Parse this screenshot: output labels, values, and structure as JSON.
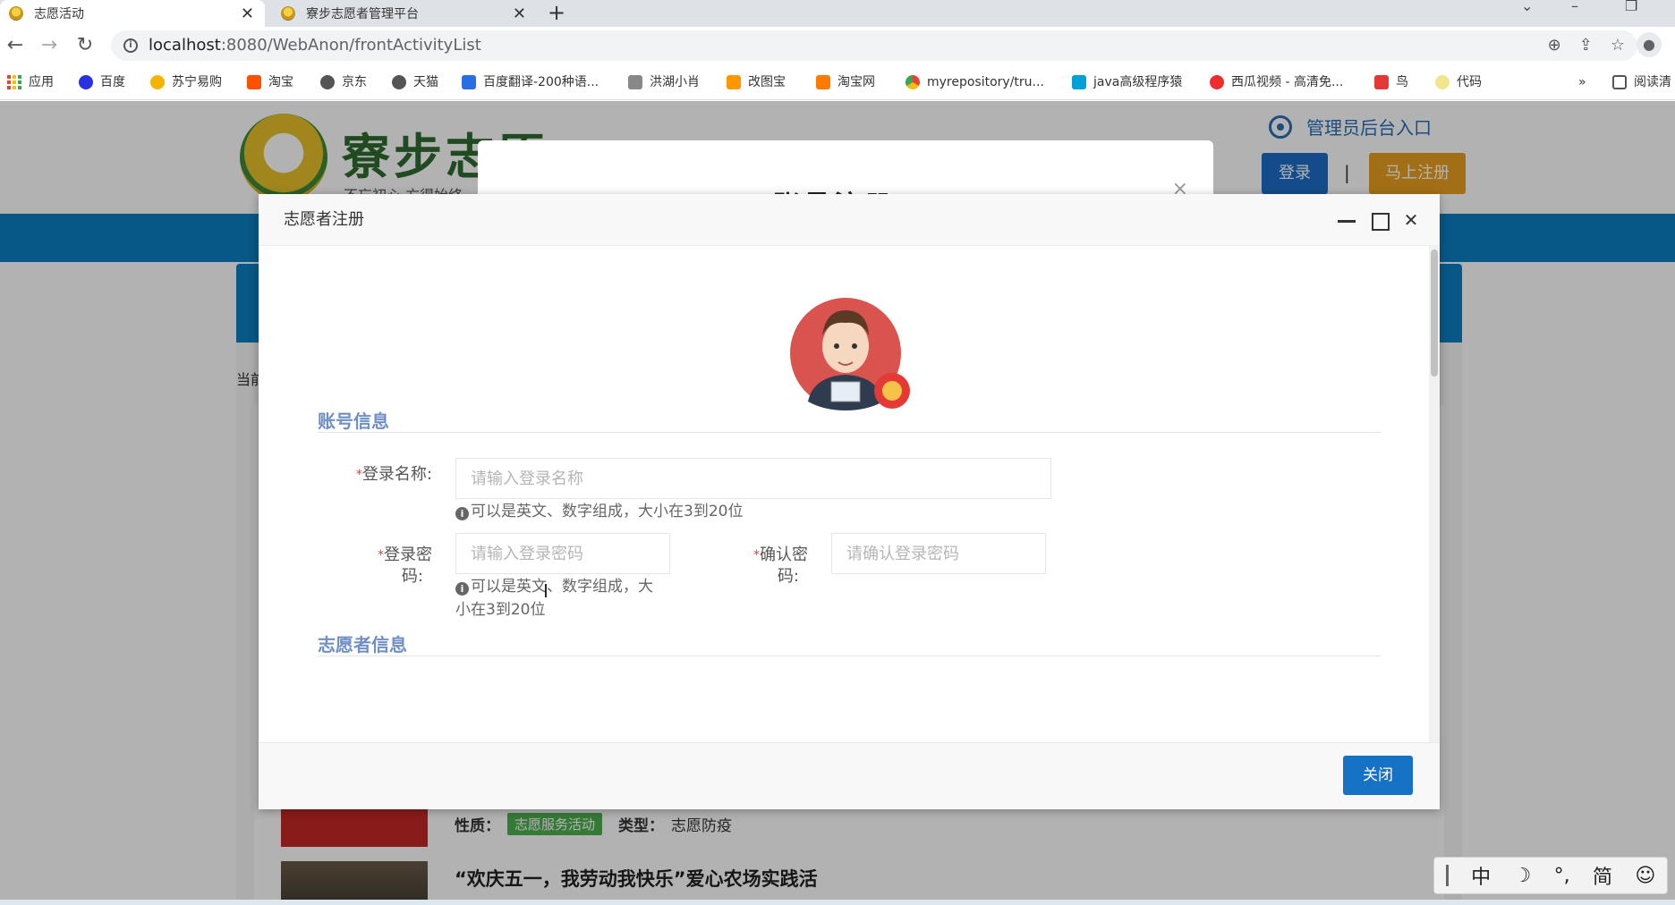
{
  "browser": {
    "tabs": [
      {
        "title": "志愿活动",
        "active": true
      },
      {
        "title": "寮步志愿者管理平台",
        "active": false
      }
    ],
    "new_tab": "+",
    "url_host": "localhost",
    "url_rest": ":8080/WebAnon/frontActivityList",
    "bookmarks": [
      "应用",
      "百度",
      "苏宁易购",
      "淘宝",
      "京东",
      "天猫",
      "百度翻译-200种语...",
      "洪湖小肖",
      "改图宝",
      "淘宝网",
      "myrepository/tru...",
      "java高级程序猿",
      "西瓜视频 - 高清免...",
      "鸟",
      "代码"
    ],
    "bookmarks_more": "»",
    "reading_list": "阅读清"
  },
  "site": {
    "logo_text": "寮步志愿",
    "logo_sub": "不忘初心  方得始终",
    "admin_link": "管理员后台入口",
    "login": "登录",
    "separator": "|",
    "register": "马上注册",
    "breadcrumb": "当前",
    "activity": {
      "nature_label": "性质：",
      "nature_tag": "志愿服务活动",
      "type_label": "类型：",
      "type_value": "志愿防疫",
      "title2": "“欢庆五一，我劳动我快乐”爱心农场实践活"
    }
  },
  "back_dialog": {
    "title": "账号注册",
    "close": "×"
  },
  "dialog": {
    "title": "志愿者注册",
    "close_glyph": "✕",
    "section_account": "账号信息",
    "section_volunteer": "志愿者信息",
    "login_name": {
      "required": "*",
      "label": "登录名称:",
      "placeholder": "请输入登录名称",
      "hint": "可以是英文、数字组成，大小在3到20位"
    },
    "password": {
      "required": "*",
      "label_line1": "登录密",
      "label_line2": "码:",
      "placeholder": "请输入登录密码",
      "hint_line1": "可以是英文、数字组成，大",
      "hint_line2": "小在3到20位"
    },
    "confirm": {
      "required": "*",
      "label_line1": "确认密",
      "label_line2": "码:",
      "placeholder": "请确认登录密码"
    },
    "close_button": "关闭"
  },
  "ime": [
    "中",
    "☽",
    "°,",
    "简",
    "☺"
  ],
  "colors": {
    "primary": "#1672c4",
    "section": "#6f8fc5",
    "nav_band": "#0b7ec2",
    "register": "#e8a020"
  }
}
